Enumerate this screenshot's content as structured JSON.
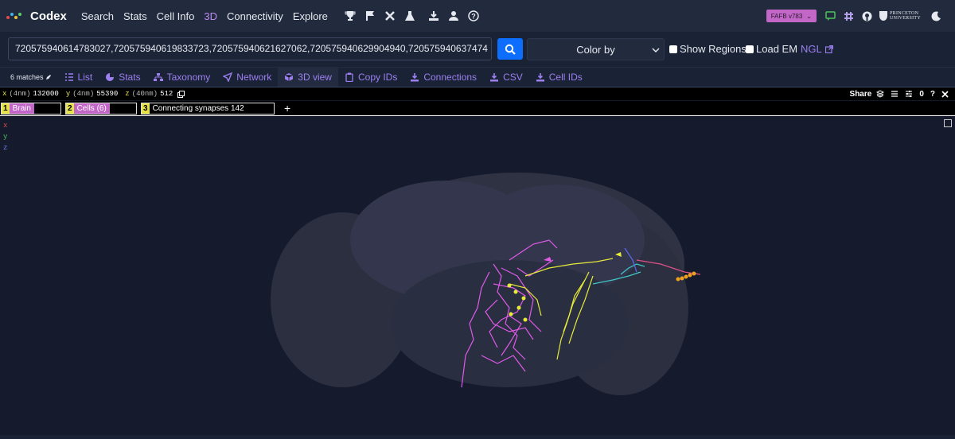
{
  "nav": {
    "brand": "Codex",
    "links": [
      "Search",
      "Stats",
      "Cell Info",
      "3D",
      "Connectivity",
      "Explore"
    ],
    "active_link": "3D",
    "icons": [
      "trophy-icon",
      "flag-icon",
      "tools-icon",
      "flask-icon",
      "download-icon",
      "user-icon",
      "help-icon"
    ],
    "version": "FAFB v783",
    "right_icons": [
      "chat-icon",
      "slack-icon",
      "github-icon"
    ],
    "princeton_line1": "PRINCETON",
    "princeton_line2": "UNIVERSITY",
    "theme_icon": "moon-icon"
  },
  "search": {
    "value": "720575940614783027,720575940619833723,720575940621627062,720575940629904940,720575940637474",
    "color_by": "Color by",
    "show_regions": "Show Regions",
    "load_em": "Load EM",
    "ngl": "NGL"
  },
  "toolbar": {
    "matches": "6 matches",
    "items": [
      "List",
      "Stats",
      "Taxonomy",
      "Network",
      "3D view",
      "Copy IDs",
      "Connections",
      "CSV",
      "Cell IDs"
    ],
    "active": "3D view"
  },
  "viewer": {
    "x_label": "x",
    "x_unit": "(4nm)",
    "x_val": "132000",
    "y_label": "y",
    "y_unit": "(4nm)",
    "y_val": "55390",
    "z_label": "z",
    "z_unit": "(40nm)",
    "z_val": "512",
    "share": "Share",
    "layers": [
      {
        "num": "1",
        "name": "Brain"
      },
      {
        "num": "2",
        "name": "Cells (6)"
      },
      {
        "num": "3",
        "name": "Connecting synapses 142"
      }
    ],
    "add": "+",
    "axes": [
      "x",
      "y",
      "z"
    ],
    "zero": "0",
    "question": "?"
  },
  "colors": {
    "magenta": "#e05ae8",
    "yellow": "#e6ea3a",
    "cyan": "#3ec8c8",
    "orange": "#f0a020",
    "accent": "#9d7ff0"
  }
}
